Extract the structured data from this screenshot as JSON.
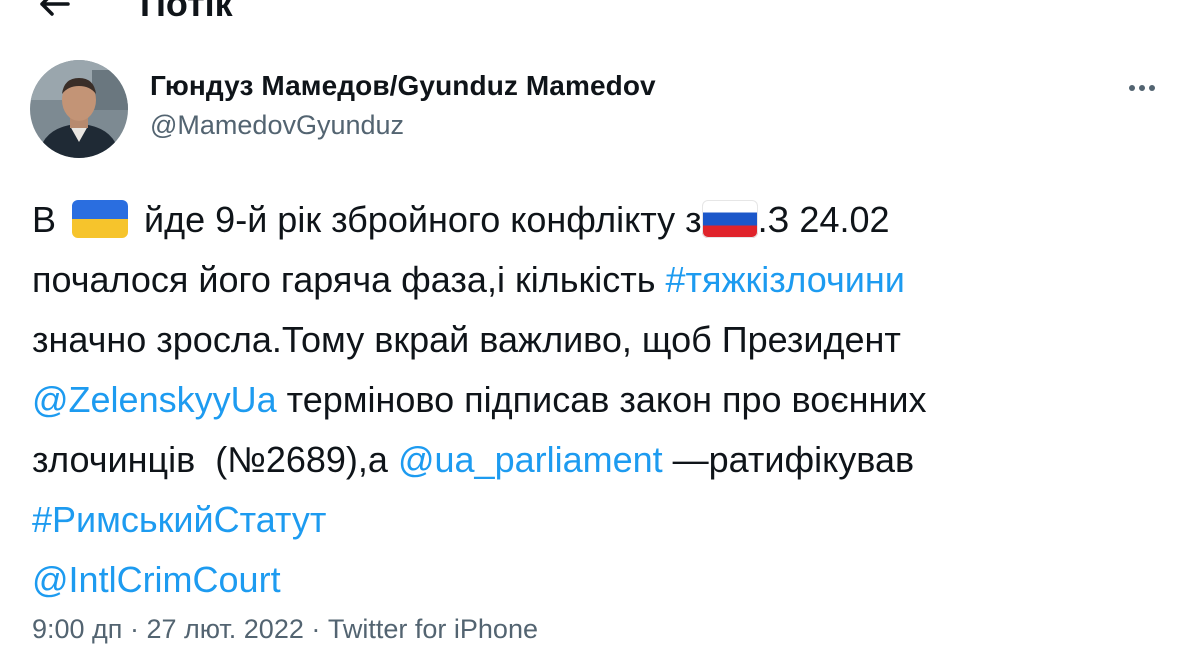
{
  "header": {
    "title": "Потік",
    "back_icon": "arrow-left-icon"
  },
  "author": {
    "display_name": "Гюндуз Мамедов/Gyunduz Mamedov",
    "handle": "@MamedovGyunduz",
    "more_icon": "more-horizontal-icon"
  },
  "tweet": {
    "line1": {
      "a": "В",
      "b": "йде 9-й рік збройного конфлікту з",
      "c": ".З 24.02"
    },
    "line2": {
      "a": "почалося його гаряча фаза,і кількість ",
      "hashtag": "#тяжкізлочини"
    },
    "line3": "значно зросла.Тому вкрай важливо, щоб Президент",
    "line4": {
      "mention": "@ZelenskyyUa",
      "b": " терміново підписав закон про воєнних"
    },
    "line5": {
      "a": "злочинців  (№2689),а ",
      "mention": "@ua_parliament",
      "b": " —ратифікував"
    },
    "line6": "#РимськийСтатут",
    "line7": "@IntlCrimCourt",
    "flags": [
      "ukraine-flag-icon",
      "russia-flag-icon"
    ],
    "colors": {
      "link": "#1d9bf0",
      "text": "#0f1419",
      "secondary": "#536471"
    }
  },
  "meta": {
    "time": "9:00 дп",
    "separator": "·",
    "date": "27 лют. 2022",
    "source": "Twitter for iPhone"
  }
}
